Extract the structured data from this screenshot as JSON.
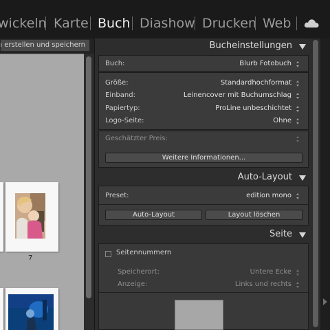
{
  "modules": [
    {
      "label": "wickeln",
      "active": false
    },
    {
      "label": "Karte",
      "active": false
    },
    {
      "label": "Buch",
      "active": true
    },
    {
      "label": "Diashow",
      "active": false
    },
    {
      "label": "Drucken",
      "active": false
    },
    {
      "label": "Web",
      "active": false
    }
  ],
  "toolbar": {
    "save_book_label": "uch erstellen und speichern"
  },
  "grid": {
    "page_numbers": [
      "7"
    ]
  },
  "book_settings": {
    "title": "Bucheinstellungen",
    "book_label": "Buch:",
    "book_value": "Blurb Fotobuch",
    "size_label": "Größe:",
    "size_value": "Standardhochformat",
    "binding_label": "Einband:",
    "binding_value": "Leinencover mit Buchumschlag",
    "paper_label": "Papiertyp:",
    "paper_value": "ProLine unbeschichtet",
    "logo_label": "Logo-Seite:",
    "logo_value": "Ohne",
    "price_label": "Geschätzter Preis:",
    "price_value": "",
    "more_info_button": "Weitere Informationen..."
  },
  "auto_layout": {
    "title": "Auto-Layout",
    "preset_label": "Preset:",
    "preset_value": "edition mono",
    "auto_layout_button": "Auto-Layout",
    "clear_layout_button": "Layout löschen"
  },
  "page_section": {
    "title": "Seite",
    "page_numbers_label": "Seitennummern",
    "page_numbers_checked": false,
    "location_label": "Speicherort:",
    "location_value": "Untere Ecke",
    "display_label": "Anzeige:",
    "display_value": "Links und rechts"
  },
  "colors": {
    "accent_panel": "#3b3b3b",
    "background": "#1e1e1e",
    "grid_bg": "#a9a9a9"
  },
  "icons": {
    "cloud": "cloud-icon",
    "collapse": "triangle-down-icon"
  }
}
